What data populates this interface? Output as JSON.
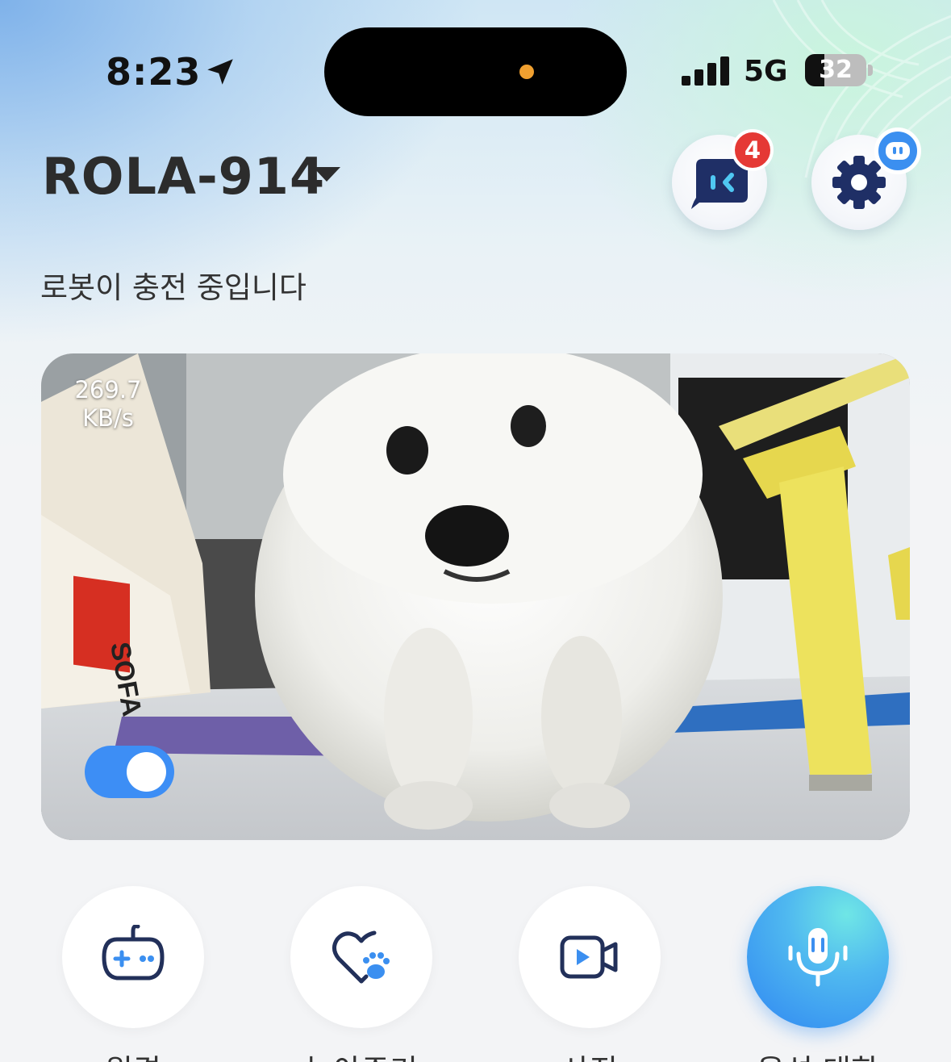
{
  "status_bar": {
    "time": "8:23",
    "network": "5G",
    "battery": "32",
    "battery_level": 0.32
  },
  "header": {
    "device_name": "ROLA-914",
    "status_message": "로봇이 충전 중입니다",
    "message_badge_count": "4"
  },
  "video": {
    "bitrate_value": "269.7",
    "bitrate_unit": "KB/s",
    "toggle_on": true,
    "sofa_label": "SOFA"
  },
  "actions": [
    {
      "label": "원격",
      "icon": "gamepad-icon"
    },
    {
      "label": "놀아주기",
      "icon": "heart-paw-icon"
    },
    {
      "label": "사진",
      "icon": "video-camera-icon"
    },
    {
      "label": "음성 대화",
      "icon": "microphone-icon"
    }
  ],
  "colors": {
    "accent": "#3d8ef5",
    "badge": "#e53935",
    "icon_dark": "#22305a"
  }
}
